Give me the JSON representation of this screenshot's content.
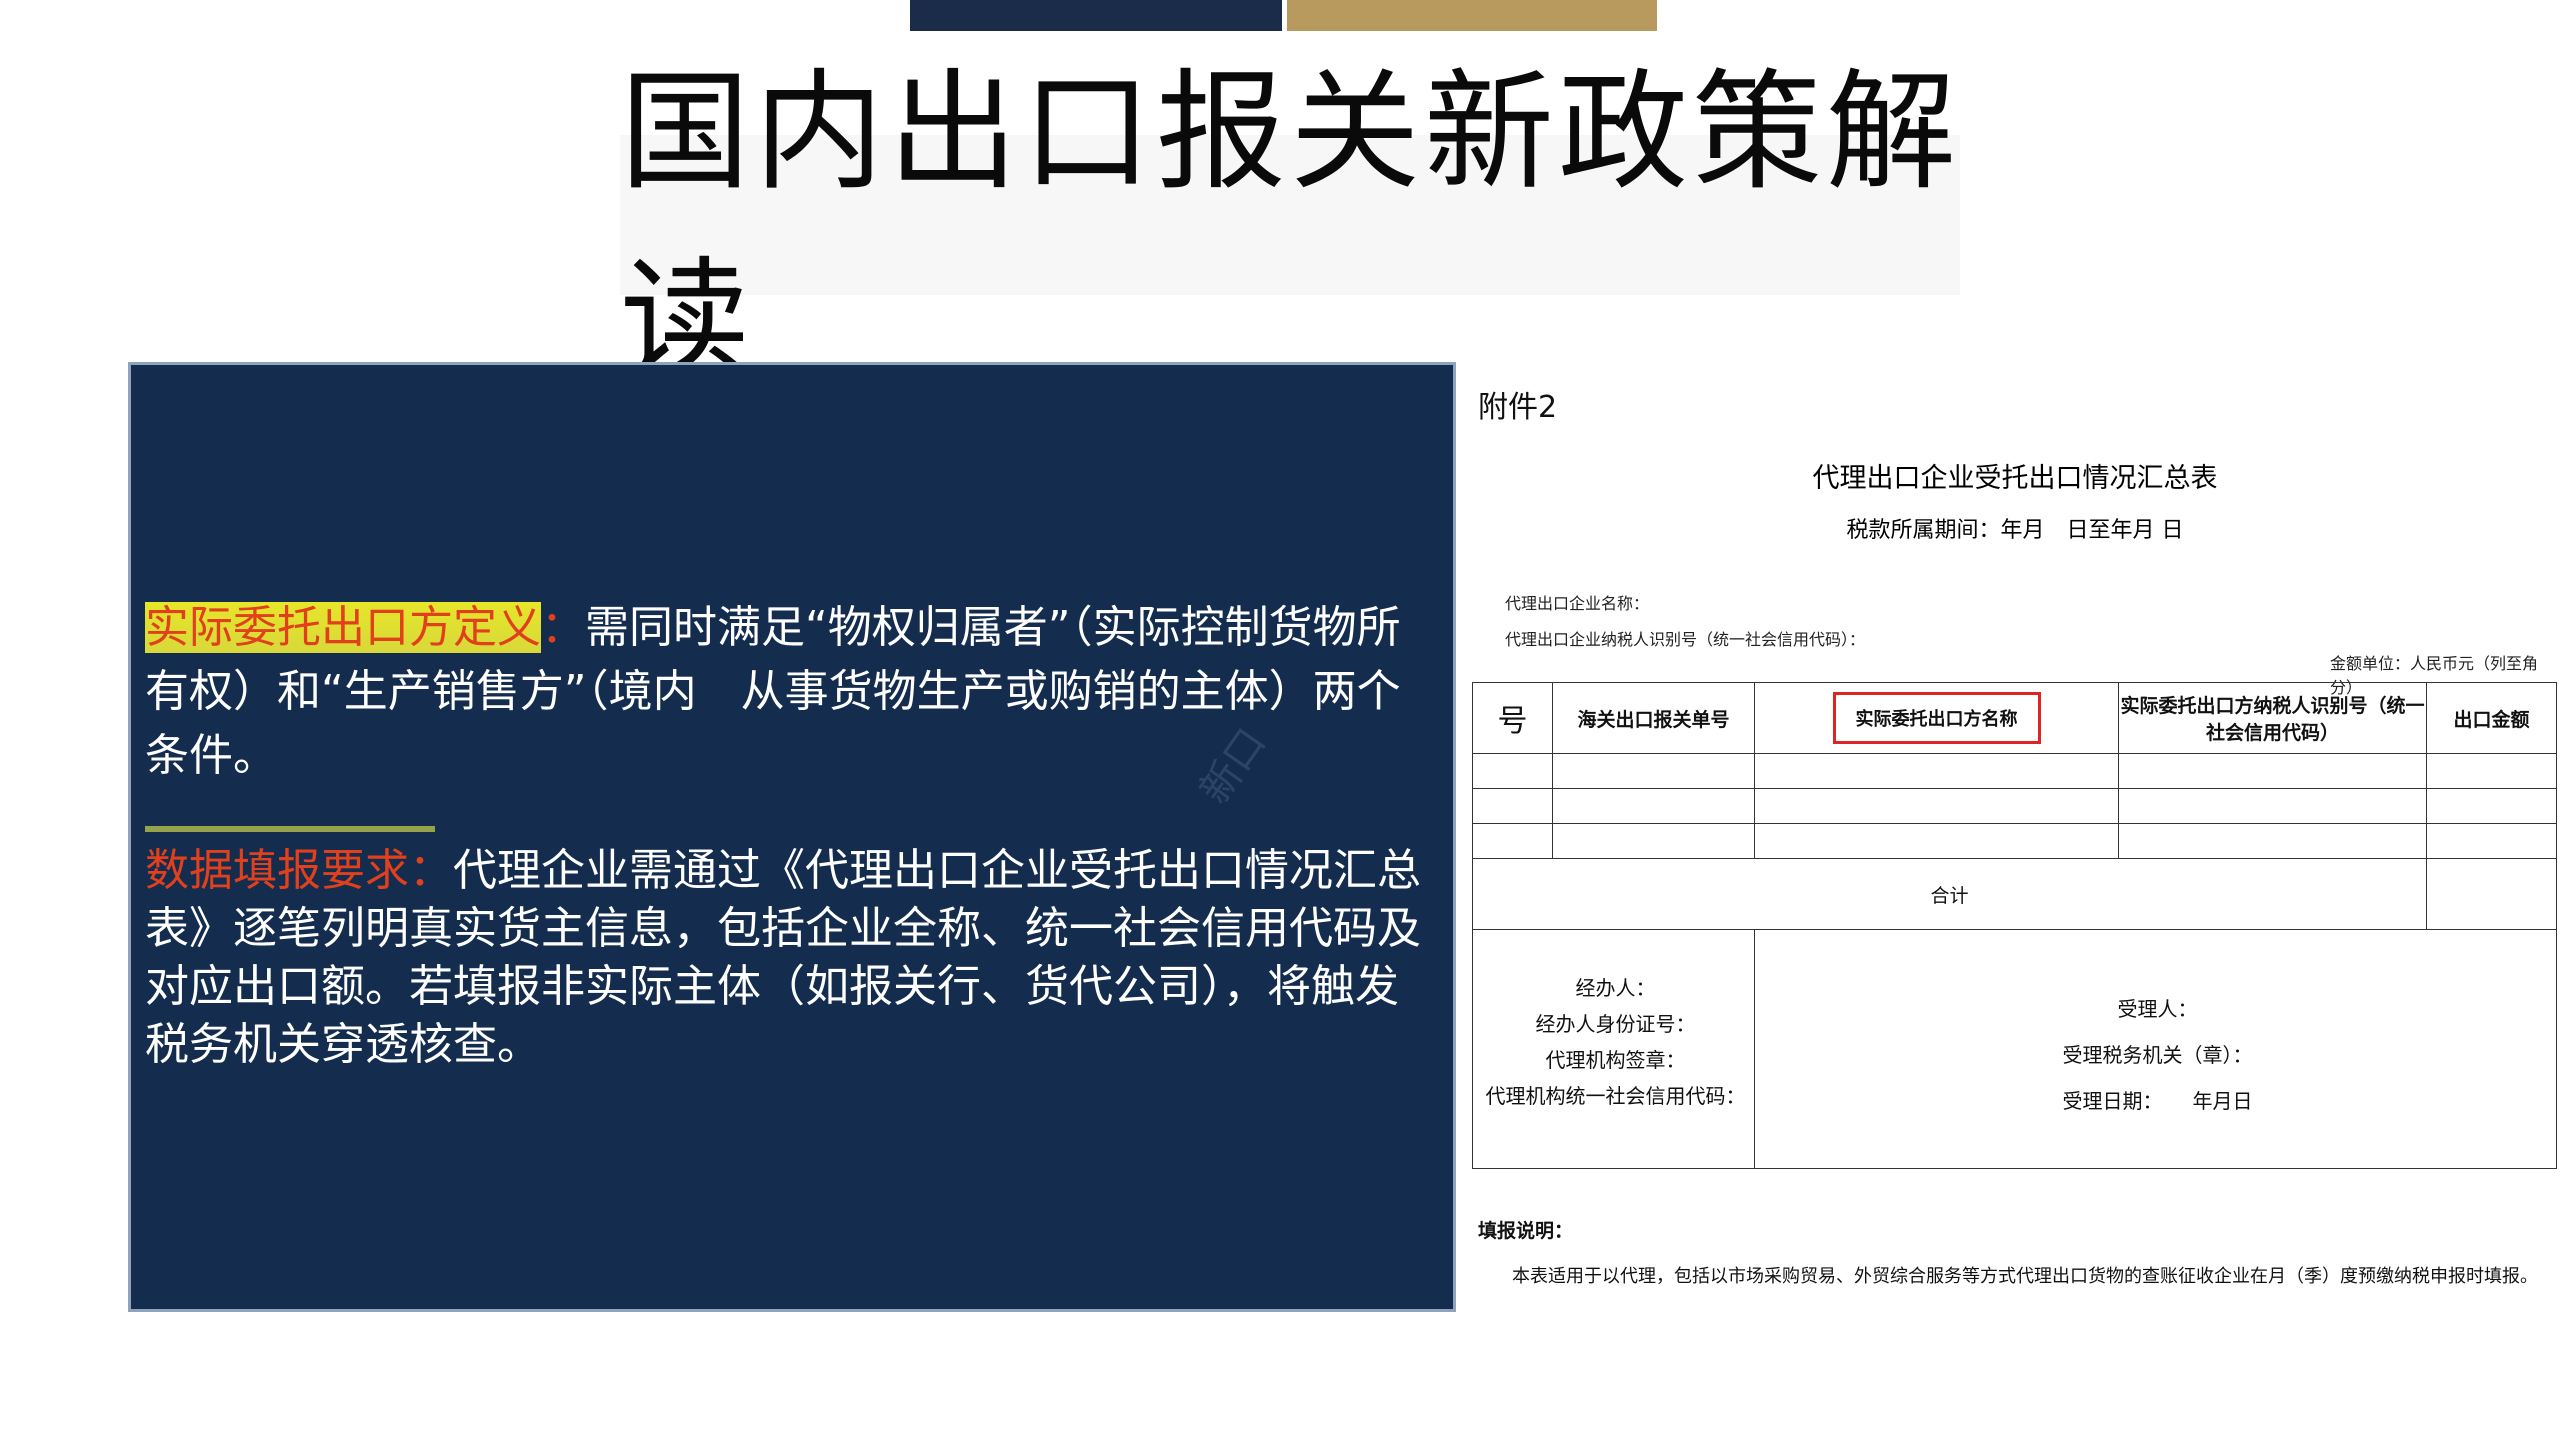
{
  "slide": {
    "title": "国内出口报关新政策解读"
  },
  "left_panel": {
    "p1_label": "实际委托出口方定义",
    "p1_colon": "：",
    "p1_text": "需同时满足“物权归属者”（实际控制货物所有权）和“生产销售方”（境内　从事货物生产或购销的主体）两个条件。",
    "p2_label": "数据填报要求：",
    "p2_text": "代理企业需通过《代理出口企业受托出口情况汇总表》逐笔列明真实货主信息，包括企业全称、统一社会信用代码及对应出口额。若填报非实际主体（如报关行、货代公司），将触发税务机关穿透核查。",
    "watermark": "新口"
  },
  "document": {
    "attachment": "附件2",
    "form_title": "代理出口企业受托出口情况汇总表",
    "period": "税款所属期间：年月　日至年月 日",
    "company_name_label": "代理出口企业名称：",
    "tax_id_label": "代理出口企业纳税人识别号（统一社会信用代码）：",
    "unit_label": "金额单位：人民币元（列至角分）",
    "table": {
      "headers": [
        "号",
        "海关出口报关单号",
        "实际委托出口方名称",
        "实际委托出口方纳税人识别号（统一社会信用代码）",
        "出口金额"
      ],
      "total_label": "合计"
    },
    "signature_left": [
      "经办人：",
      "经办人身份证号：",
      "代理机构签章：",
      "代理机构统一社会信用代码："
    ],
    "signature_right": [
      "受理人：",
      "受理税务机关（章）：",
      "受理日期：　　年月日"
    ],
    "fill_title": "填报说明：",
    "fill_text": "本表适用于以代理，包括以市场采购贸易、外贸综合服务等方式代理出口货物的查账征收企业在月（季）度预缴纳税申报时填报。"
  }
}
